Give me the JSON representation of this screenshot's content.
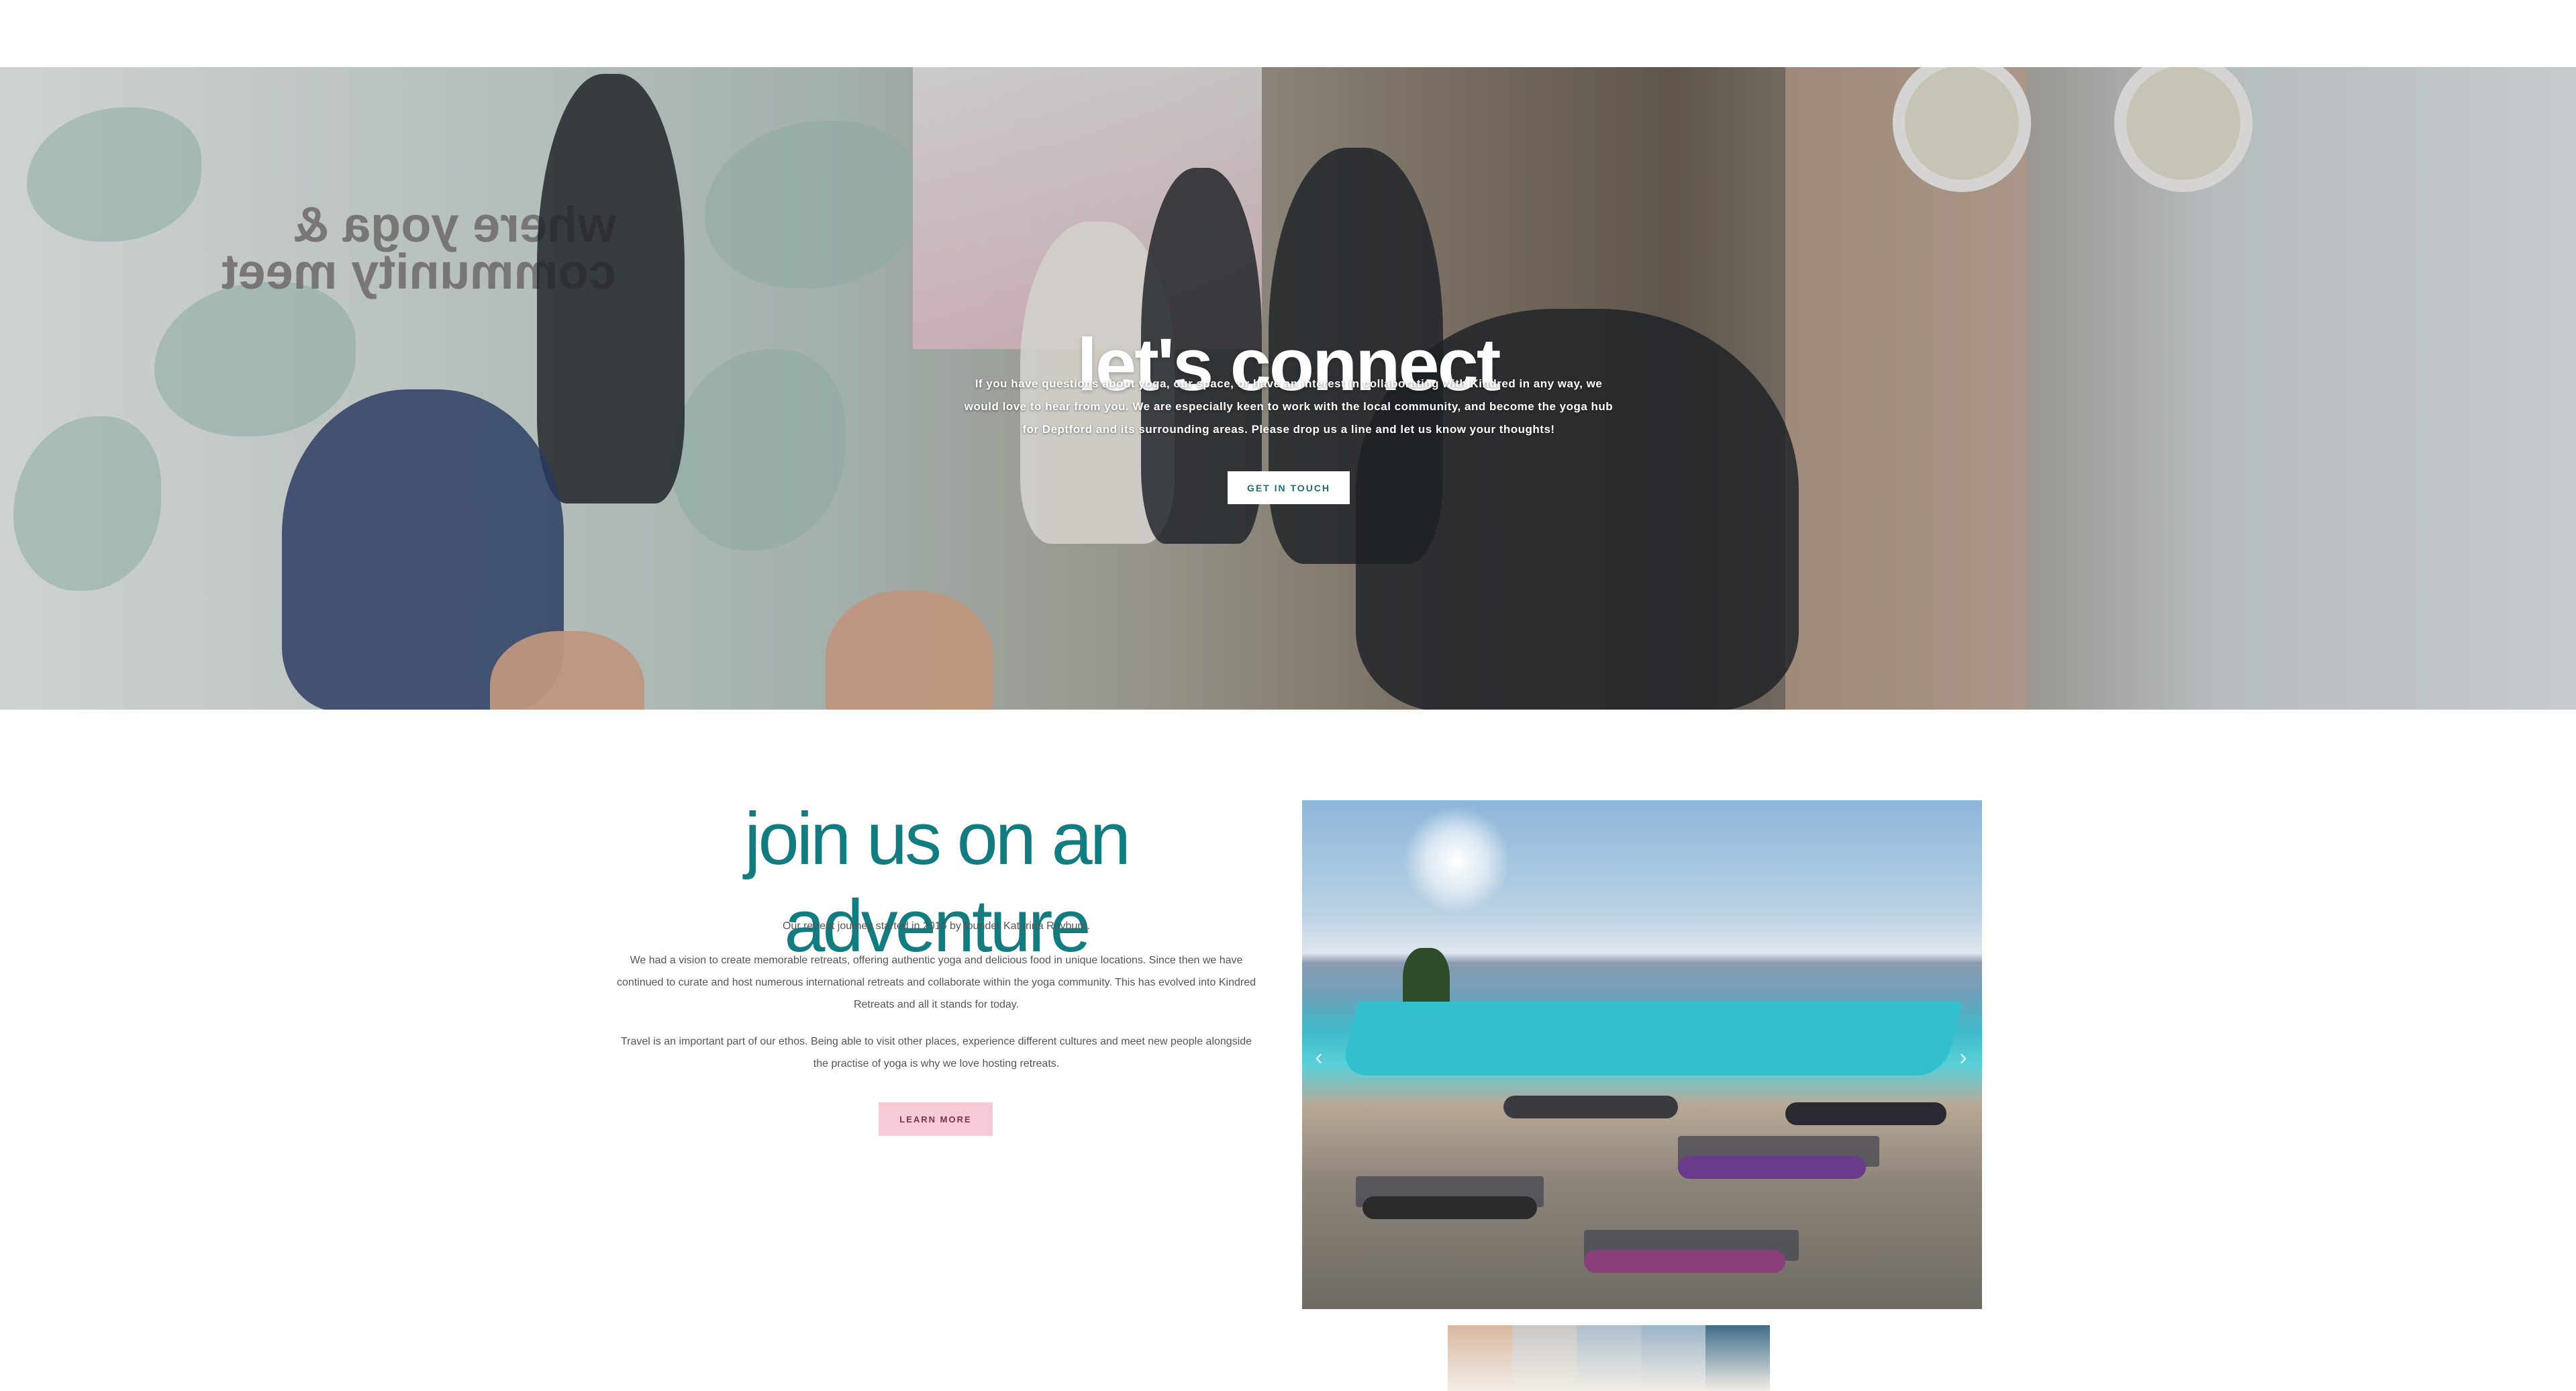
{
  "hero": {
    "title": "let's connect",
    "line1": "If you have questions about yoga, our space, or have an interest in collaborating with Kindred in any way, we",
    "line2": "would love to hear from you. We are especially keen to work with the local community, and become the yoga hub",
    "line3": "for Deptford and its surrounding areas. Please drop us a line and let us know your thoughts!",
    "button": "GET IN TOUCH",
    "wall_text": "where yoga &\ncommunity meet"
  },
  "adventure": {
    "title": "join us on an adventure",
    "para1": "Our retreat journey started in 2016 by founder Katarina Rayburn.",
    "para2_line1": "We had a vision to create memorable retreats, offering authentic yoga and delicious food in unique locations.  Since then we have",
    "para2_line2": "continued to curate and host numerous international retreats and collaborate within the yoga community. This has evolved into Kindred",
    "para2_line3": "Retreats and all it stands for today.",
    "para3_line1": "Travel is an important part of our ethos. Being able to visit other places, experience different cultures and meet new people alongside",
    "para3_line2": "the practise of yoga is why we love hosting retreats.",
    "button": "LEARN MORE"
  },
  "gallery": {
    "prev": "‹",
    "next": "›",
    "thumbs": [
      "#d9b89e",
      "#c9c8c6",
      "#aebfcc",
      "#9db5c8",
      "#3f6c8a"
    ]
  },
  "colors": {
    "teal": "#127c80",
    "pink": "#f8c9d6",
    "button_text": "#1d6f78"
  }
}
